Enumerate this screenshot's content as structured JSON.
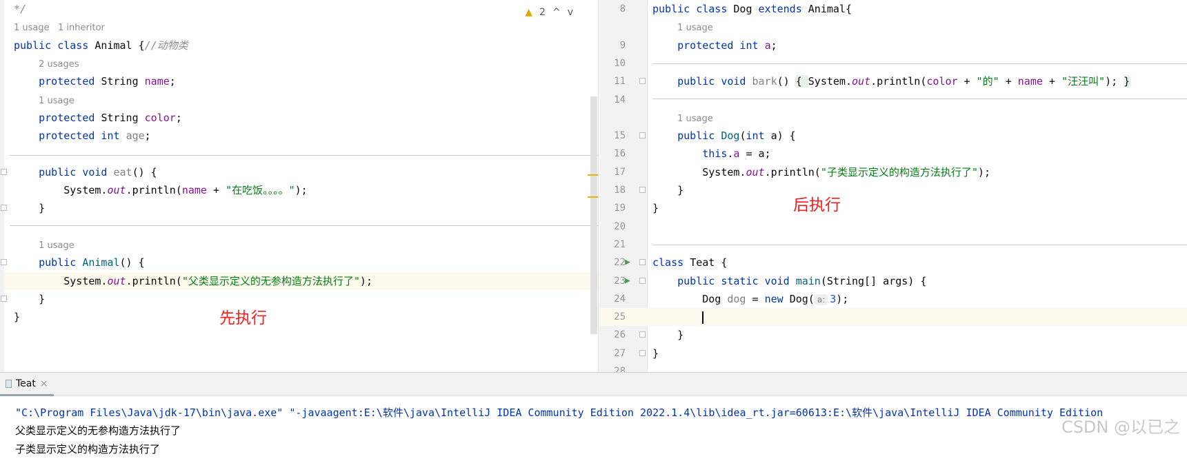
{
  "left_editor": {
    "problems": {
      "icon": "warning-icon",
      "count": "2",
      "up": "^",
      "down": "v"
    },
    "rows": [
      [
        {
          "t": "*/",
          "c": "cm"
        }
      ],
      [
        {
          "t": "1 usage   1 inheritor",
          "c": "hint"
        }
      ],
      [
        {
          "t": "public class ",
          "c": "kw"
        },
        {
          "t": "Animal {"
        },
        {
          "t": "//动物类",
          "c": "cm"
        }
      ],
      [
        {
          "t": "    "
        },
        {
          "t": "2 usages",
          "c": "hint"
        }
      ],
      [
        {
          "t": "    "
        },
        {
          "t": "protected ",
          "c": "kw"
        },
        {
          "t": "String "
        },
        {
          "t": "name",
          "c": "fld"
        },
        {
          "t": ";"
        }
      ],
      [
        {
          "t": "    "
        },
        {
          "t": "1 usage",
          "c": "hint"
        }
      ],
      [
        {
          "t": "    "
        },
        {
          "t": "protected ",
          "c": "kw"
        },
        {
          "t": "String "
        },
        {
          "t": "color",
          "c": "fld"
        },
        {
          "t": ";"
        }
      ],
      [
        {
          "t": "    "
        },
        {
          "t": "protected int ",
          "c": "kw"
        },
        {
          "t": "age",
          "c": "gr"
        },
        {
          "t": ";"
        }
      ],
      [],
      [
        {
          "t": "    "
        },
        {
          "t": "public void ",
          "c": "kw"
        },
        {
          "t": "eat",
          "c": "gr"
        },
        {
          "t": "() {"
        }
      ],
      [
        {
          "t": "        System."
        },
        {
          "t": "out",
          "c": "it"
        },
        {
          "t": ".println("
        },
        {
          "t": "name",
          "c": "fld"
        },
        {
          "t": " + "
        },
        {
          "t": "\"在吃饭。。。。\"",
          "c": "str"
        },
        {
          "t": ");"
        }
      ],
      [
        {
          "t": "    }"
        }
      ],
      [],
      [
        {
          "t": "    "
        },
        {
          "t": "1 usage",
          "c": "hint"
        }
      ],
      [
        {
          "t": "    "
        },
        {
          "t": "public ",
          "c": "kw"
        },
        {
          "t": "Animal",
          "c": "md"
        },
        {
          "t": "() {"
        }
      ],
      [
        {
          "t": "        System."
        },
        {
          "t": "out",
          "c": "it"
        },
        {
          "t": ".println("
        },
        {
          "t": "\"父类显示定义的无参构造方法执行了\"",
          "c": "str"
        },
        {
          "t": ");"
        }
      ],
      [
        {
          "t": "    }"
        }
      ],
      [
        {
          "t": "}"
        }
      ]
    ],
    "annotation": "先执行"
  },
  "right_editor": {
    "rows": [
      {
        "n": "8",
        "tokens": [
          {
            "t": "public class ",
            "c": "kw"
          },
          {
            "t": "Dog "
          },
          {
            "t": "extends ",
            "c": "kw"
          },
          {
            "t": "Animal{"
          }
        ]
      },
      {
        "n": "",
        "tokens": [
          {
            "t": "    "
          },
          {
            "t": "1 usage",
            "c": "hint"
          }
        ]
      },
      {
        "n": "9",
        "tokens": [
          {
            "t": "    "
          },
          {
            "t": "protected int ",
            "c": "kw"
          },
          {
            "t": "a",
            "c": "fld"
          },
          {
            "t": ";"
          }
        ]
      },
      {
        "n": "10",
        "tokens": []
      },
      {
        "n": "11",
        "tokens": [
          {
            "t": "    "
          },
          {
            "t": "public void ",
            "c": "kw"
          },
          {
            "t": "bark",
            "c": "gr"
          },
          {
            "t": "() "
          },
          {
            "t": "{ ",
            "c": "brace"
          },
          {
            "t": "System."
          },
          {
            "t": "out",
            "c": "it"
          },
          {
            "t": ".println("
          },
          {
            "t": "color",
            "c": "fld"
          },
          {
            "t": " + "
          },
          {
            "t": "\"的\"",
            "c": "str"
          },
          {
            "t": " + "
          },
          {
            "t": "name",
            "c": "fld"
          },
          {
            "t": " + "
          },
          {
            "t": "\"汪汪叫\"",
            "c": "str"
          },
          {
            "t": "); "
          },
          {
            "t": "}",
            "c": "brace"
          }
        ]
      },
      {
        "n": "14",
        "tokens": []
      },
      {
        "n": "",
        "tokens": [
          {
            "t": "    "
          },
          {
            "t": "1 usage",
            "c": "hint"
          }
        ]
      },
      {
        "n": "15",
        "tokens": [
          {
            "t": "    "
          },
          {
            "t": "public ",
            "c": "kw"
          },
          {
            "t": "Dog",
            "c": "md"
          },
          {
            "t": "("
          },
          {
            "t": "int ",
            "c": "kw"
          },
          {
            "t": "a) {"
          }
        ]
      },
      {
        "n": "16",
        "tokens": [
          {
            "t": "        "
          },
          {
            "t": "this",
            "c": "kw"
          },
          {
            "t": "."
          },
          {
            "t": "a",
            "c": "fld"
          },
          {
            "t": " = a;"
          }
        ]
      },
      {
        "n": "17",
        "tokens": [
          {
            "t": "        System."
          },
          {
            "t": "out",
            "c": "it"
          },
          {
            "t": ".println("
          },
          {
            "t": "\"子类显示定义的构造方法执行了\"",
            "c": "str"
          },
          {
            "t": ");"
          }
        ]
      },
      {
        "n": "18",
        "tokens": [
          {
            "t": "    }"
          }
        ]
      },
      {
        "n": "19",
        "tokens": [
          {
            "t": "}"
          }
        ]
      },
      {
        "n": "20",
        "tokens": []
      },
      {
        "n": "21",
        "tokens": []
      },
      {
        "n": "22",
        "tokens": [
          {
            "t": "class ",
            "c": "kw"
          },
          {
            "t": "Teat {"
          }
        ]
      },
      {
        "n": "23",
        "tokens": [
          {
            "t": "    "
          },
          {
            "t": "public static void ",
            "c": "kw"
          },
          {
            "t": "main",
            "c": "md"
          },
          {
            "t": "(String[] args) {"
          }
        ]
      },
      {
        "n": "24",
        "tokens": [
          {
            "t": "        Dog "
          },
          {
            "t": "dog",
            "c": "gr"
          },
          {
            "t": " = "
          },
          {
            "t": "new ",
            "c": "kw"
          },
          {
            "t": "Dog("
          },
          {
            "t": "a:",
            "c": "inl"
          },
          {
            "t": "3",
            "c": "num"
          },
          {
            "t": ");"
          }
        ]
      },
      {
        "n": "25",
        "tokens": [
          {
            "t": "        "
          },
          {
            "t": "",
            "c": "caret"
          }
        ]
      },
      {
        "n": "26",
        "tokens": [
          {
            "t": "    }"
          }
        ]
      },
      {
        "n": "27",
        "tokens": [
          {
            "t": "}"
          }
        ]
      },
      {
        "n": "28",
        "tokens": []
      }
    ],
    "annotation": "后执行"
  },
  "run_panel": {
    "tab_label": "Teat",
    "close": "×",
    "command": "\"C:\\Program Files\\Java\\jdk-17\\bin\\java.exe\" \"-javaagent:E:\\软件\\java\\IntelliJ IDEA Community Edition 2022.1.4\\lib\\idea_rt.jar=60613:E:\\软件\\java\\IntelliJ IDEA Community Edition",
    "output": [
      "父类显示定义的无参构造方法执行了",
      "子类显示定义的构造方法执行了"
    ]
  },
  "watermark": "CSDN @以已之"
}
